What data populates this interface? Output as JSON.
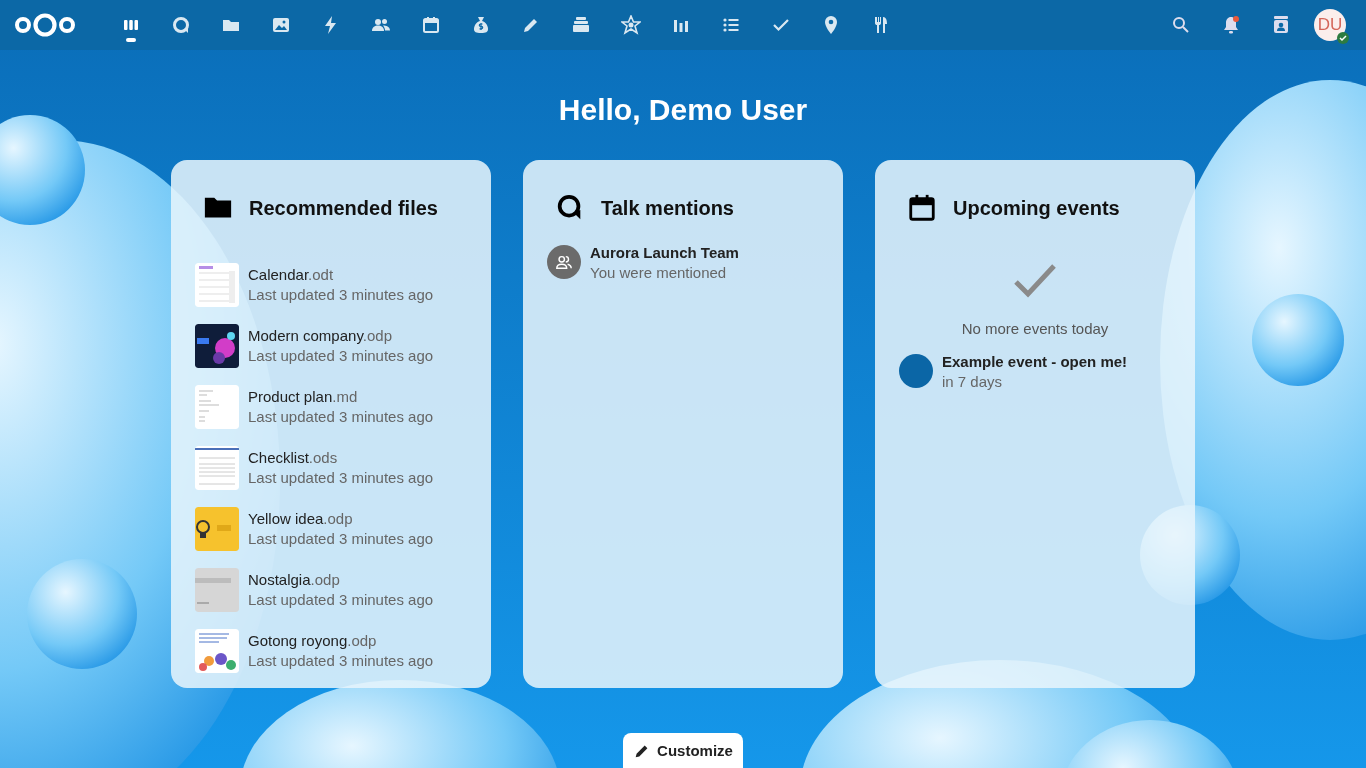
{
  "topbar": {
    "apps": [
      {
        "selected": true
      },
      {
        "selected": false
      },
      {
        "selected": false
      },
      {
        "selected": false
      },
      {
        "selected": false
      },
      {
        "selected": false
      },
      {
        "selected": false
      },
      {
        "selected": false
      },
      {
        "selected": false
      },
      {
        "selected": false
      },
      {
        "selected": false
      },
      {
        "selected": false
      },
      {
        "selected": false
      },
      {
        "selected": false
      },
      {
        "selected": false
      },
      {
        "selected": false
      }
    ],
    "notifications": {
      "unread": true
    },
    "avatar": {
      "initials": "DU",
      "online": true
    }
  },
  "greeting": "Hello, Demo User",
  "widgets": [
    {
      "kind": "files",
      "title": "Recommended files",
      "items": [
        {
          "name": "Calendar",
          "extension": ".odt",
          "subtitle": "Last updated 3 minutes ago"
        },
        {
          "name": "Modern company",
          "extension": ".odp",
          "subtitle": "Last updated 3 minutes ago"
        },
        {
          "name": "Product plan",
          "extension": ".md",
          "subtitle": "Last updated 3 minutes ago"
        },
        {
          "name": "Checklist",
          "extension": ".ods",
          "subtitle": "Last updated 3 minutes ago"
        },
        {
          "name": "Yellow idea",
          "extension": ".odp",
          "subtitle": "Last updated 3 minutes ago"
        },
        {
          "name": "Nostalgia",
          "extension": ".odp",
          "subtitle": "Last updated 3 minutes ago"
        },
        {
          "name": "Gotong royong",
          "extension": ".odp",
          "subtitle": "Last updated 3 minutes ago"
        }
      ]
    },
    {
      "kind": "talk",
      "title": "Talk mentions",
      "items": [
        {
          "title": "Aurora Launch Team",
          "subtitle": "You were mentioned"
        }
      ]
    },
    {
      "kind": "events",
      "title": "Upcoming events",
      "empty_text": "No more events today",
      "items": [
        {
          "title": "Example event - open me!",
          "subtitle": "in 7 days",
          "color": "#0b66a6"
        }
      ]
    }
  ],
  "customize_button": "Customize"
}
